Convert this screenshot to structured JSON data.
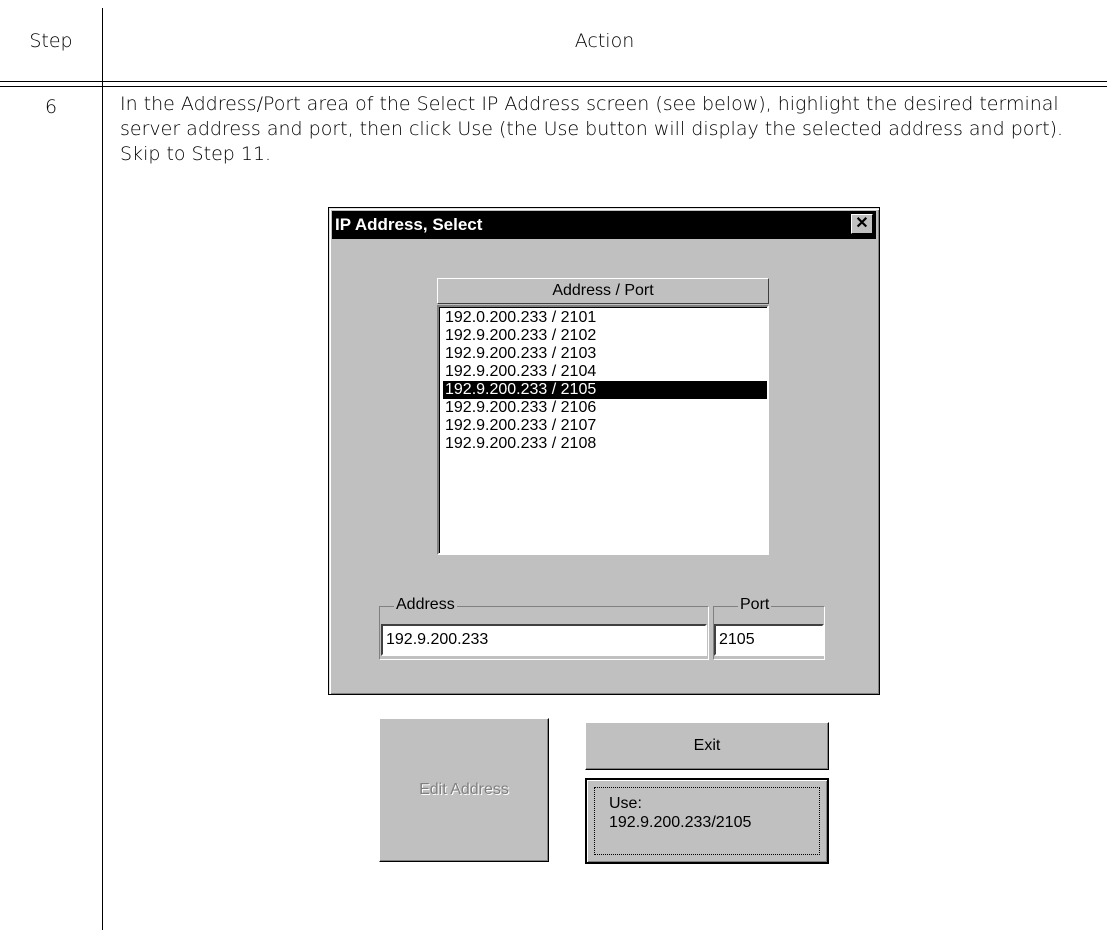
{
  "table": {
    "header_step": "Step",
    "header_action": "Action",
    "row_step": "6",
    "row_text": "In the Address/Port area of the Select IP Address screen (see below), highlight the desired terminal server address and port, then click Use (the Use button will display the selected address and port). Skip to Step 11."
  },
  "dialog": {
    "title": "IP Address, Select",
    "close_glyph": "✕",
    "list_header": "Address / Port",
    "list_items": [
      "192.0.200.233 / 2101",
      "192.9.200.233 / 2102",
      "192.9.200.233 / 2103",
      "192.9.200.233 / 2104",
      "192.9.200.233 / 2105",
      "192.9.200.233 / 2106",
      "192.9.200.233 / 2107",
      "192.9.200.233 / 2108"
    ],
    "selected_index": 4,
    "address_label": "Address",
    "address_value": "192.9.200.233",
    "port_label": "Port",
    "port_value": "2105",
    "edit_address_label": "Edit Address",
    "exit_label": "Exit",
    "use_label_line1": "Use:",
    "use_label_line2": "192.9.200.233/2105"
  }
}
